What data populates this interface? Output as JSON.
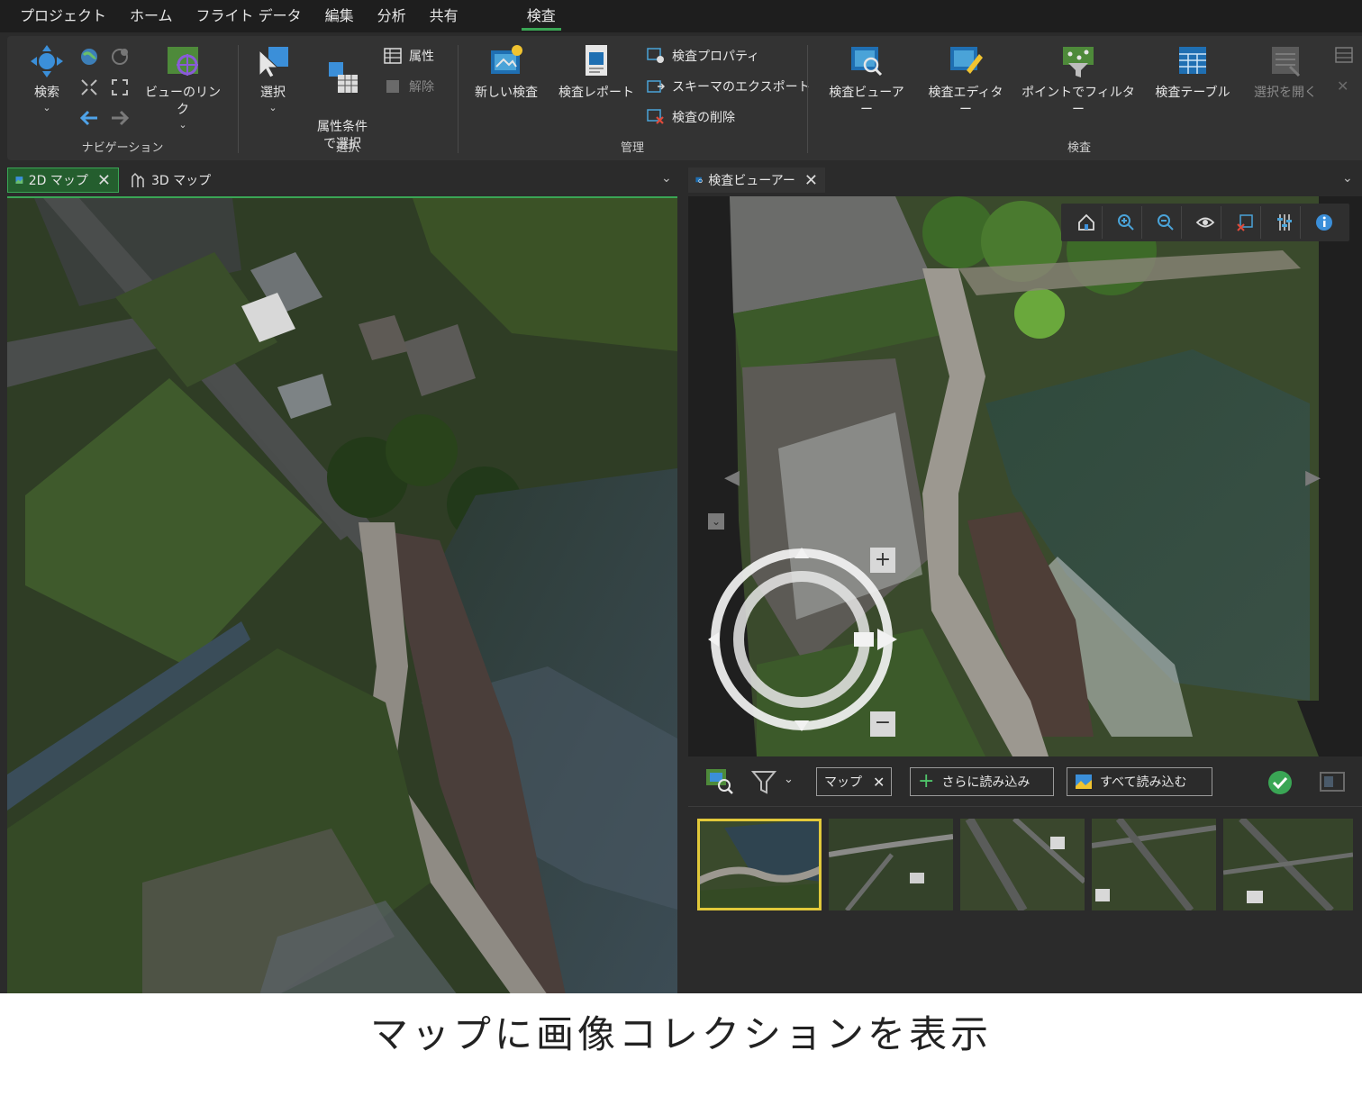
{
  "menubar": {
    "items": [
      "プロジェクト",
      "ホーム",
      "フライト データ",
      "編集",
      "分析",
      "共有"
    ],
    "active": "検査"
  },
  "ribbon": {
    "navigation": {
      "label": "ナビゲーション",
      "search": "検索",
      "link_views": "ビューのリンク"
    },
    "selection": {
      "label": "選択",
      "select": "選択",
      "select_by_attr": "属性条件\nで選択",
      "attributes": "属性",
      "clear": "解除"
    },
    "manage": {
      "label": "管理",
      "new_inspection": "新しい検査",
      "inspection_report": "検査レポート",
      "inspection_properties": "検査プロパティ",
      "export_schema": "スキーマのエクスポート",
      "delete_inspection": "検査の削除"
    },
    "inspection": {
      "label": "検査",
      "viewer": "検査ビューアー",
      "editor": "検査エディター",
      "filter_by_points": "ポイントでフィルター",
      "table": "検査テーブル",
      "open_selection": "選択を開く"
    }
  },
  "left_pane": {
    "tabs": [
      {
        "label": "2D マップ",
        "active": true
      },
      {
        "label": "3D マップ",
        "active": false
      }
    ]
  },
  "right_pane": {
    "tab": "検査ビューアー"
  },
  "gallery": {
    "map_chip": "マップ",
    "load_more": "さらに読み込み",
    "load_all": "すべて読み込む",
    "thumbnail_count": 5,
    "selected_index": 0
  },
  "caption": "マップに画像コレクションを表示",
  "colors": {
    "accent_green": "#3aa655",
    "selection_yellow": "#e2c93a",
    "ribbon_bg": "#333333",
    "menubar_bg": "#1e1e1e"
  }
}
